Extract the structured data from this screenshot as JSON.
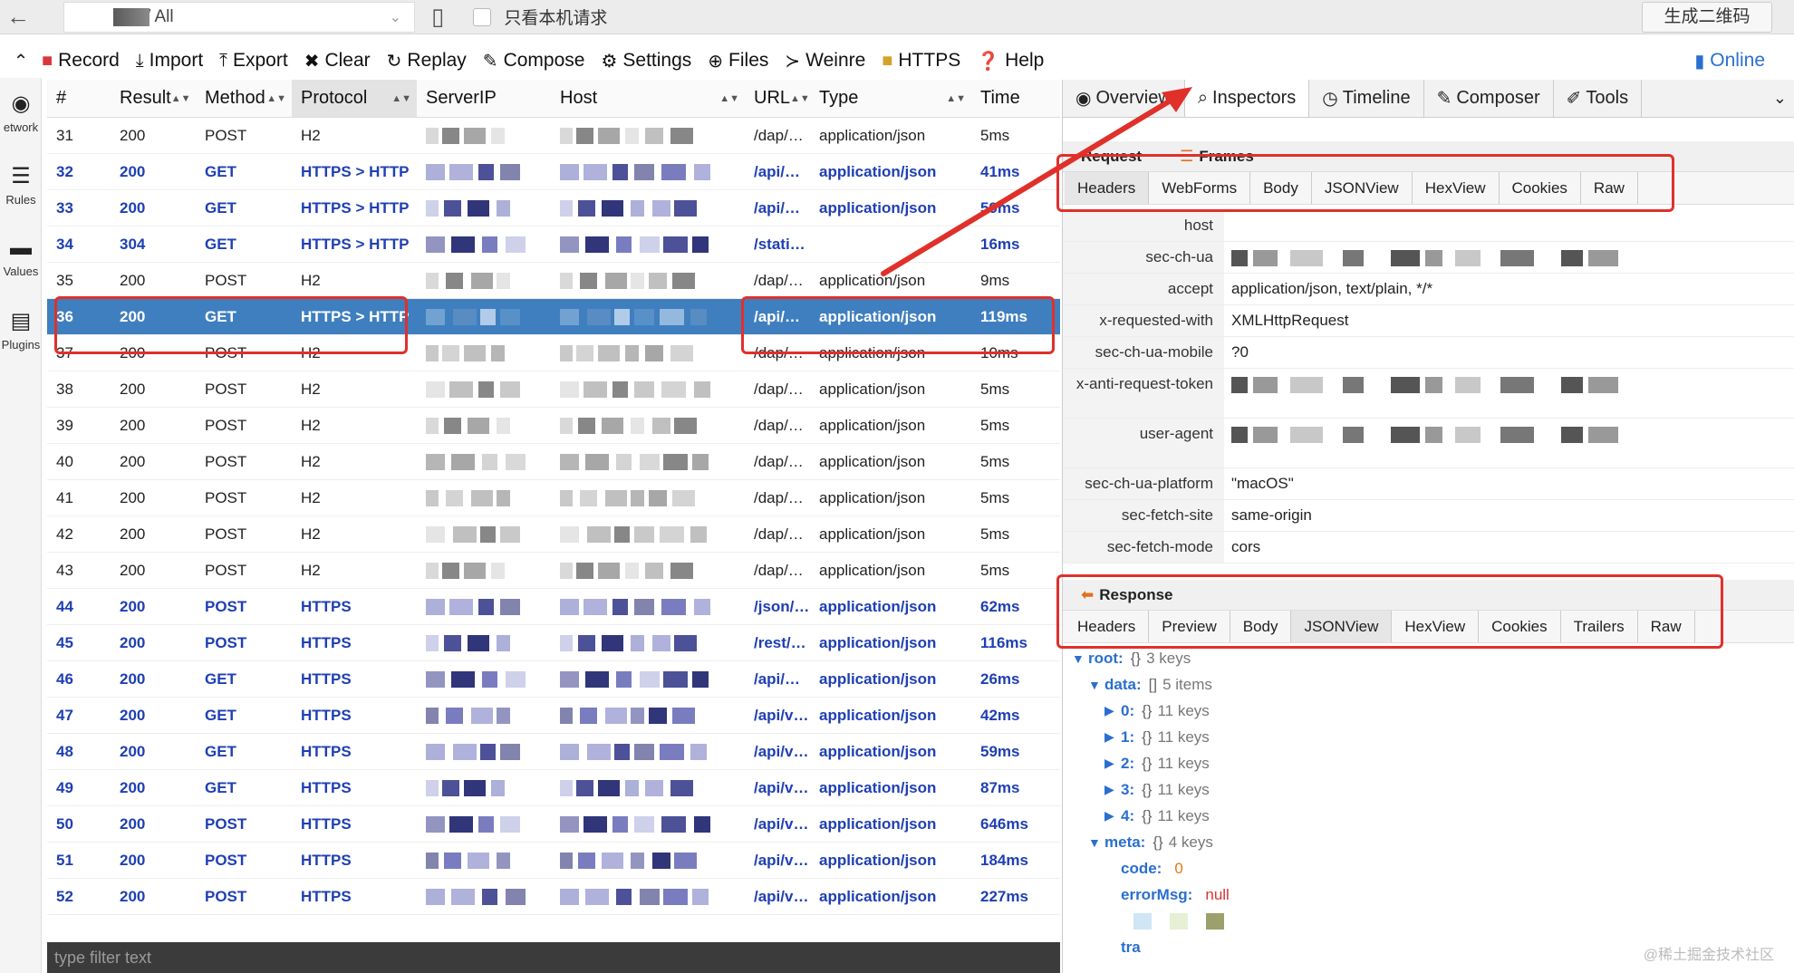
{
  "topbar": {
    "process_label": "/ All",
    "local_only_label": "只看本机请求",
    "qr_button": "生成二维码"
  },
  "toolbar": {
    "items": [
      {
        "label": "Record",
        "icon": "record-icon"
      },
      {
        "label": "Import",
        "icon": "import-icon"
      },
      {
        "label": "Export",
        "icon": "export-icon"
      },
      {
        "label": "Clear",
        "icon": "clear-icon"
      },
      {
        "label": "Replay",
        "icon": "replay-icon"
      },
      {
        "label": "Compose",
        "icon": "compose-icon"
      },
      {
        "label": "Settings",
        "icon": "gear-icon"
      },
      {
        "label": "Files",
        "icon": "files-icon"
      },
      {
        "label": "Weinre",
        "icon": "terminal-icon"
      },
      {
        "label": "HTTPS",
        "icon": "lock-icon"
      },
      {
        "label": "Help",
        "icon": "help-icon"
      }
    ],
    "online_label": "Online"
  },
  "sidebar": {
    "items": [
      {
        "label": "etwork",
        "icon": "network-icon"
      },
      {
        "label": "Rules",
        "icon": "rules-icon"
      },
      {
        "label": "Values",
        "icon": "values-icon"
      },
      {
        "label": "Plugins",
        "icon": "plugins-icon"
      }
    ]
  },
  "list": {
    "columns": [
      "#",
      "Result",
      "Method",
      "Protocol",
      "ServerIP",
      "Host",
      "URL",
      "Type",
      "Time"
    ],
    "rows": [
      {
        "num": "31",
        "result": "200",
        "method": "POST",
        "protocol": "H2",
        "url": "/dap/…",
        "type": "application/json",
        "time": "5ms",
        "kind": "plain"
      },
      {
        "num": "32",
        "result": "200",
        "method": "GET",
        "protocol": "HTTPS > HTTP",
        "url": "/api/…",
        "type": "application/json",
        "time": "41ms",
        "kind": "https"
      },
      {
        "num": "33",
        "result": "200",
        "method": "GET",
        "protocol": "HTTPS > HTTP",
        "url": "/api/…",
        "type": "application/json",
        "time": "59ms",
        "kind": "https"
      },
      {
        "num": "34",
        "result": "304",
        "method": "GET",
        "protocol": "HTTPS > HTTP",
        "url": "/stati…",
        "type": "",
        "time": "16ms",
        "kind": "https"
      },
      {
        "num": "35",
        "result": "200",
        "method": "POST",
        "protocol": "H2",
        "url": "/dap/…",
        "type": "application/json",
        "time": "9ms",
        "kind": "plain"
      },
      {
        "num": "36",
        "result": "200",
        "method": "GET",
        "protocol": "HTTPS > HTTP",
        "url": "/api/…",
        "type": "application/json",
        "time": "119ms",
        "kind": "selected"
      },
      {
        "num": "37",
        "result": "200",
        "method": "POST",
        "protocol": "H2",
        "url": "/dap/…",
        "type": "application/json",
        "time": "10ms",
        "kind": "plain"
      },
      {
        "num": "38",
        "result": "200",
        "method": "POST",
        "protocol": "H2",
        "url": "/dap/…",
        "type": "application/json",
        "time": "5ms",
        "kind": "plain"
      },
      {
        "num": "39",
        "result": "200",
        "method": "POST",
        "protocol": "H2",
        "url": "/dap/…",
        "type": "application/json",
        "time": "5ms",
        "kind": "plain"
      },
      {
        "num": "40",
        "result": "200",
        "method": "POST",
        "protocol": "H2",
        "url": "/dap/…",
        "type": "application/json",
        "time": "5ms",
        "kind": "plain"
      },
      {
        "num": "41",
        "result": "200",
        "method": "POST",
        "protocol": "H2",
        "url": "/dap/…",
        "type": "application/json",
        "time": "5ms",
        "kind": "plain"
      },
      {
        "num": "42",
        "result": "200",
        "method": "POST",
        "protocol": "H2",
        "url": "/dap/…",
        "type": "application/json",
        "time": "5ms",
        "kind": "plain"
      },
      {
        "num": "43",
        "result": "200",
        "method": "POST",
        "protocol": "H2",
        "url": "/dap/…",
        "type": "application/json",
        "time": "5ms",
        "kind": "plain"
      },
      {
        "num": "44",
        "result": "200",
        "method": "POST",
        "protocol": "HTTPS",
        "url": "/json/…",
        "type": "application/json",
        "time": "62ms",
        "kind": "https"
      },
      {
        "num": "45",
        "result": "200",
        "method": "POST",
        "protocol": "HTTPS",
        "url": "/rest/…",
        "type": "application/json",
        "time": "116ms",
        "kind": "https"
      },
      {
        "num": "46",
        "result": "200",
        "method": "GET",
        "protocol": "HTTPS",
        "url": "/api/…",
        "type": "application/json",
        "time": "26ms",
        "kind": "https"
      },
      {
        "num": "47",
        "result": "200",
        "method": "GET",
        "protocol": "HTTPS",
        "url": "/api/v…",
        "type": "application/json",
        "time": "42ms",
        "kind": "https"
      },
      {
        "num": "48",
        "result": "200",
        "method": "GET",
        "protocol": "HTTPS",
        "url": "/api/v…",
        "type": "application/json",
        "time": "59ms",
        "kind": "https"
      },
      {
        "num": "49",
        "result": "200",
        "method": "GET",
        "protocol": "HTTPS",
        "url": "/api/v…",
        "type": "application/json",
        "time": "87ms",
        "kind": "https"
      },
      {
        "num": "50",
        "result": "200",
        "method": "POST",
        "protocol": "HTTPS",
        "url": "/api/v…",
        "type": "application/json",
        "time": "646ms",
        "kind": "https"
      },
      {
        "num": "51",
        "result": "200",
        "method": "POST",
        "protocol": "HTTPS",
        "url": "/api/v…",
        "type": "application/json",
        "time": "184ms",
        "kind": "https"
      },
      {
        "num": "52",
        "result": "200",
        "method": "POST",
        "protocol": "HTTPS",
        "url": "/api/v…",
        "type": "application/json",
        "time": "227ms",
        "kind": "https"
      }
    ],
    "filter_placeholder": "type filter text"
  },
  "right": {
    "tabs": [
      {
        "label": "Overview",
        "icon": "eye-icon"
      },
      {
        "label": "Inspectors",
        "icon": "search-icon"
      },
      {
        "label": "Timeline",
        "icon": "clock-icon"
      },
      {
        "label": "Composer",
        "icon": "edit-icon"
      },
      {
        "label": "Tools",
        "icon": "wrench-icon"
      }
    ],
    "request_label": "Request",
    "frames_label": "Frames",
    "request_tabs": [
      "Headers",
      "WebForms",
      "Body",
      "JSONView",
      "HexView",
      "Cookies",
      "Raw"
    ],
    "headers": [
      {
        "key": "host",
        "value": ""
      },
      {
        "key": "sec-ch-ua",
        "value": ""
      },
      {
        "key": "accept",
        "value": "application/json, text/plain, */*"
      },
      {
        "key": "x-requested-with",
        "value": "XMLHttpRequest"
      },
      {
        "key": "sec-ch-ua-mobile",
        "value": "?0"
      },
      {
        "key": "x-anti-request-token",
        "value": ""
      },
      {
        "key": "user-agent",
        "value": ""
      },
      {
        "key": "sec-ch-ua-platform",
        "value": "\"macOS\""
      },
      {
        "key": "sec-fetch-site",
        "value": "same-origin"
      },
      {
        "key": "sec-fetch-mode",
        "value": "cors"
      }
    ],
    "response_label": "Response",
    "response_tabs": [
      "Headers",
      "Preview",
      "Body",
      "JSONView",
      "HexView",
      "Cookies",
      "Trailers",
      "Raw"
    ],
    "tree": [
      {
        "indent": 0,
        "toggle": "▼",
        "key": "root:",
        "bracket": "{}",
        "count": "3 keys"
      },
      {
        "indent": 1,
        "toggle": "▼",
        "key": "data:",
        "bracket": "[]",
        "count": "5 items"
      },
      {
        "indent": 2,
        "toggle": "▶",
        "key": "0:",
        "bracket": "{}",
        "count": "11 keys"
      },
      {
        "indent": 2,
        "toggle": "▶",
        "key": "1:",
        "bracket": "{}",
        "count": "11 keys"
      },
      {
        "indent": 2,
        "toggle": "▶",
        "key": "2:",
        "bracket": "{}",
        "count": "11 keys"
      },
      {
        "indent": 2,
        "toggle": "▶",
        "key": "3:",
        "bracket": "{}",
        "count": "11 keys"
      },
      {
        "indent": 2,
        "toggle": "▶",
        "key": "4:",
        "bracket": "{}",
        "count": "11 keys"
      },
      {
        "indent": 1,
        "toggle": "▼",
        "key": "meta:",
        "bracket": "{}",
        "count": "4 keys"
      },
      {
        "indent": 2,
        "toggle": "",
        "key": "code:",
        "bracket": "",
        "count": "0",
        "kind": "num"
      },
      {
        "indent": 2,
        "toggle": "",
        "key": "errorMsg:",
        "bracket": "",
        "count": "null",
        "kind": "null"
      },
      {
        "indent": 2,
        "toggle": "",
        "key": "",
        "bracket": "",
        "count": ""
      },
      {
        "indent": 2,
        "toggle": "",
        "key": "tra",
        "bracket": "",
        "count": ""
      }
    ],
    "watermark": "@稀土掘金技术社区"
  },
  "colors": {
    "accent_blue": "#1f3fb3",
    "selected_row": "#3f7fbf",
    "annotation_red": "#e0302a"
  }
}
